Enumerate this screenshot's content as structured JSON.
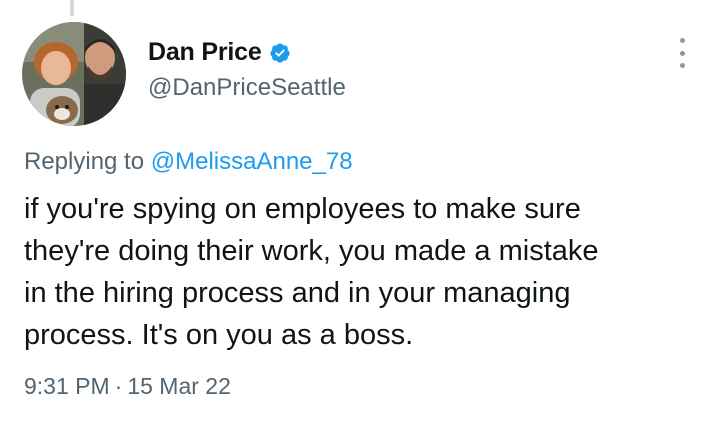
{
  "author": {
    "display_name": "Dan Price",
    "handle": "@DanPriceSeattle",
    "verified": true
  },
  "reply": {
    "prefix": "Replying to",
    "mention": "@MelissaAnne_78"
  },
  "tweet": {
    "lines": [
      "if you're spying on employees to make sure",
      "they're doing their work, you made a mistake",
      "in the hiring process and in your managing",
      "process. It's on you as a boss."
    ],
    "time": "9:31 PM",
    "separator": "·",
    "date": "15 Mar 22"
  },
  "colors": {
    "text": "#0f1419",
    "secondary": "#536471",
    "accent": "#1d9bf0"
  },
  "icons": {
    "verified": "verified-badge-icon",
    "more": "more-options-icon"
  }
}
